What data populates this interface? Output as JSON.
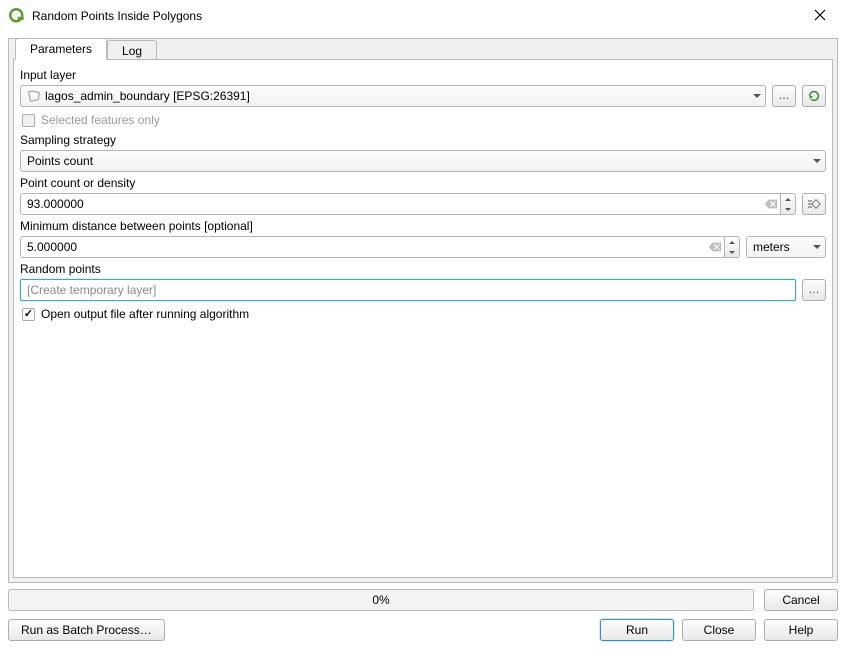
{
  "window": {
    "title": "Random Points Inside Polygons"
  },
  "tabs": {
    "parameters": "Parameters",
    "log": "Log"
  },
  "labels": {
    "input_layer": "Input layer",
    "selected_only": "Selected features only",
    "sampling_strategy": "Sampling strategy",
    "point_count": "Point count or density",
    "min_distance": "Minimum distance between points [optional]",
    "random_points": "Random points",
    "open_output": "Open output file after running algorithm"
  },
  "values": {
    "input_layer": "lagos_admin_boundary [EPSG:26391]",
    "sampling_strategy": "Points count",
    "point_count": "93.000000",
    "min_distance": "5.000000",
    "distance_unit": "meters",
    "output_placeholder": "[Create temporary layer]",
    "progress": "0%"
  },
  "buttons": {
    "cancel": "Cancel",
    "batch": "Run as Batch Process…",
    "run": "Run",
    "close": "Close",
    "help": "Help",
    "browse": "…"
  }
}
